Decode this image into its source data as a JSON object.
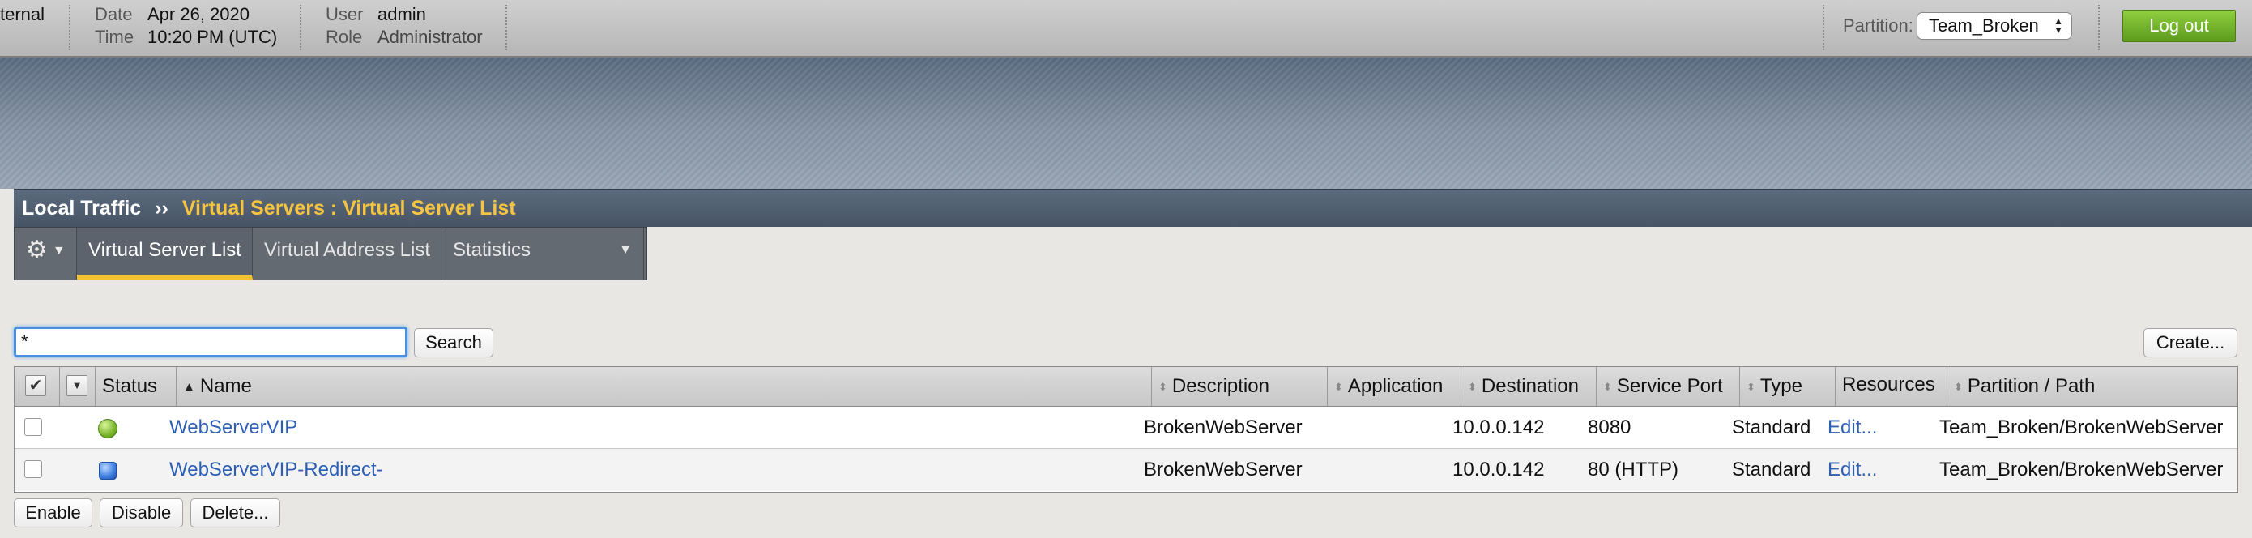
{
  "header": {
    "partial_label": "ternal",
    "date_label": "Date",
    "date_value": "Apr 26, 2020",
    "time_label": "Time",
    "time_value": "10:20 PM (UTC)",
    "user_label": "User",
    "user_value": "admin",
    "role_label": "Role",
    "role_value": "Administrator",
    "partition_label": "Partition:",
    "partition_value": "Team_Broken",
    "logout_label": "Log out"
  },
  "breadcrumb": {
    "root": "Local Traffic",
    "separator": "››",
    "current": "Virtual Servers : Virtual Server List"
  },
  "tabs": {
    "items": [
      {
        "label": "Virtual Server List"
      },
      {
        "label": "Virtual Address List"
      },
      {
        "label": "Statistics"
      }
    ]
  },
  "search": {
    "value": "*",
    "button": "Search",
    "create_button": "Create..."
  },
  "table": {
    "columns": {
      "status": "Status",
      "name": "Name",
      "description": "Description",
      "application": "Application",
      "destination": "Destination",
      "service_port": "Service Port",
      "type": "Type",
      "resources": "Resources",
      "partition_path": "Partition / Path"
    },
    "rows": [
      {
        "status": "available",
        "name": "WebServerVIP",
        "description": "BrokenWebServer",
        "application": "",
        "destination": "10.0.0.142",
        "service_port": "8080",
        "type": "Standard",
        "resources": "Edit...",
        "partition_path": "Team_Broken/BrokenWebServer"
      },
      {
        "status": "unknown",
        "name": "WebServerVIP-Redirect-",
        "description": "BrokenWebServer",
        "application": "",
        "destination": "10.0.0.142",
        "service_port": "80 (HTTP)",
        "type": "Standard",
        "resources": "Edit...",
        "partition_path": "Team_Broken/BrokenWebServer"
      }
    ]
  },
  "actions": {
    "enable": "Enable",
    "disable": "Disable",
    "delete": "Delete..."
  },
  "colors": {
    "accent_yellow": "#f5c542",
    "logout_green": "#6bac26",
    "link_blue": "#2f5fb3"
  },
  "icons": {
    "gear": "gear-icon",
    "status_available": "green-circle-icon",
    "status_unknown": "blue-square-icon"
  }
}
